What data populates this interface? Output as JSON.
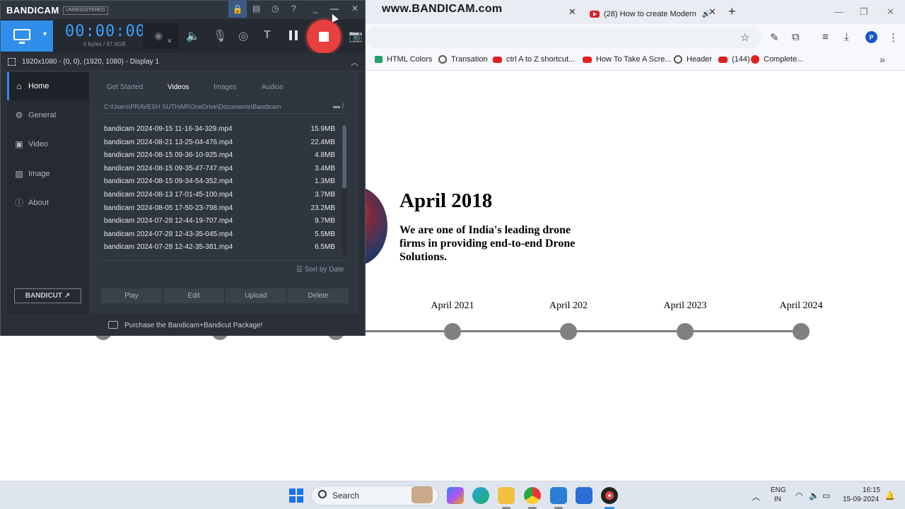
{
  "browser": {
    "watermark": "www.BANDICAM.com",
    "tabs": [
      {
        "title": "(28) How to create Modern"
      }
    ],
    "bookmarks": [
      {
        "label": "HTML Colors",
        "icon": "w"
      },
      {
        "label": "Transation",
        "icon": "globe"
      },
      {
        "label": "ctrl A to Z shortcut...",
        "icon": "yt"
      },
      {
        "label": "How To Take A Scre...",
        "icon": "yt"
      },
      {
        "label": "Header",
        "icon": "globe"
      },
      {
        "label": "(144)",
        "icon": "yt"
      },
      {
        "label": "Complete...",
        "icon": "dot"
      }
    ],
    "profile_initial": "P"
  },
  "page": {
    "card_title": "April 2018",
    "card_desc": "We are one of India's leading drone firms in providing end-to-end Drone Solutions.",
    "timeline": [
      "April 2021",
      "April 202",
      "April 2023",
      "April 2024"
    ]
  },
  "bandicam": {
    "logo": "BANDICAM",
    "unregistered": "UNREGISTERED",
    "timer": "00:00:00",
    "size_info": "0 bytes / 87.6GB",
    "region": "1920x1080 - (0, 0), (1920, 1080) - Display 1",
    "nav": [
      "Home",
      "General",
      "Video",
      "Image",
      "About"
    ],
    "tabs": [
      "Get Started",
      "Videos",
      "Images",
      "Audios"
    ],
    "active_tab": "Videos",
    "path": "C:\\Users\\PRAVESH SUTHAR\\OneDrive\\Documents\\Bandicam",
    "files": [
      {
        "name": "bandicam 2024-09-15 11-16-34-329.mp4",
        "size": "15.9MB"
      },
      {
        "name": "bandicam 2024-08-21 13-25-04-476.mp4",
        "size": "22.4MB"
      },
      {
        "name": "bandicam 2024-08-15 09-36-10-925.mp4",
        "size": "4.8MB"
      },
      {
        "name": "bandicam 2024-08-15 09-35-47-747.mp4",
        "size": "3.4MB"
      },
      {
        "name": "bandicam 2024-08-15 09-34-54-352.mp4",
        "size": "1.3MB"
      },
      {
        "name": "bandicam 2024-08-13 17-01-45-100.mp4",
        "size": "3.7MB"
      },
      {
        "name": "bandicam 2024-08-05 17-50-23-798.mp4",
        "size": "23.2MB"
      },
      {
        "name": "bandicam 2024-07-28 12-44-19-707.mp4",
        "size": "9.7MB"
      },
      {
        "name": "bandicam 2024-07-28 12-43-35-045.mp4",
        "size": "5.5MB"
      },
      {
        "name": "bandicam 2024-07-28 12-42-35-381.mp4",
        "size": "6.5MB"
      }
    ],
    "sort_label": "Sort by Date",
    "actions": [
      "Play",
      "Edit",
      "Upload",
      "Delete"
    ],
    "bandicut": "BANDICUT",
    "footer": "Purchase the Bandicam+Bandicut Package!"
  },
  "taskbar": {
    "search": "Search",
    "lang1": "ENG",
    "lang2": "IN",
    "time": "16:15",
    "date": "15-09-2024"
  },
  "colors": {
    "bandicam_accent": "#2f8eea",
    "record_red": "#e8403f",
    "timer_blue": "#3aa0ff"
  }
}
